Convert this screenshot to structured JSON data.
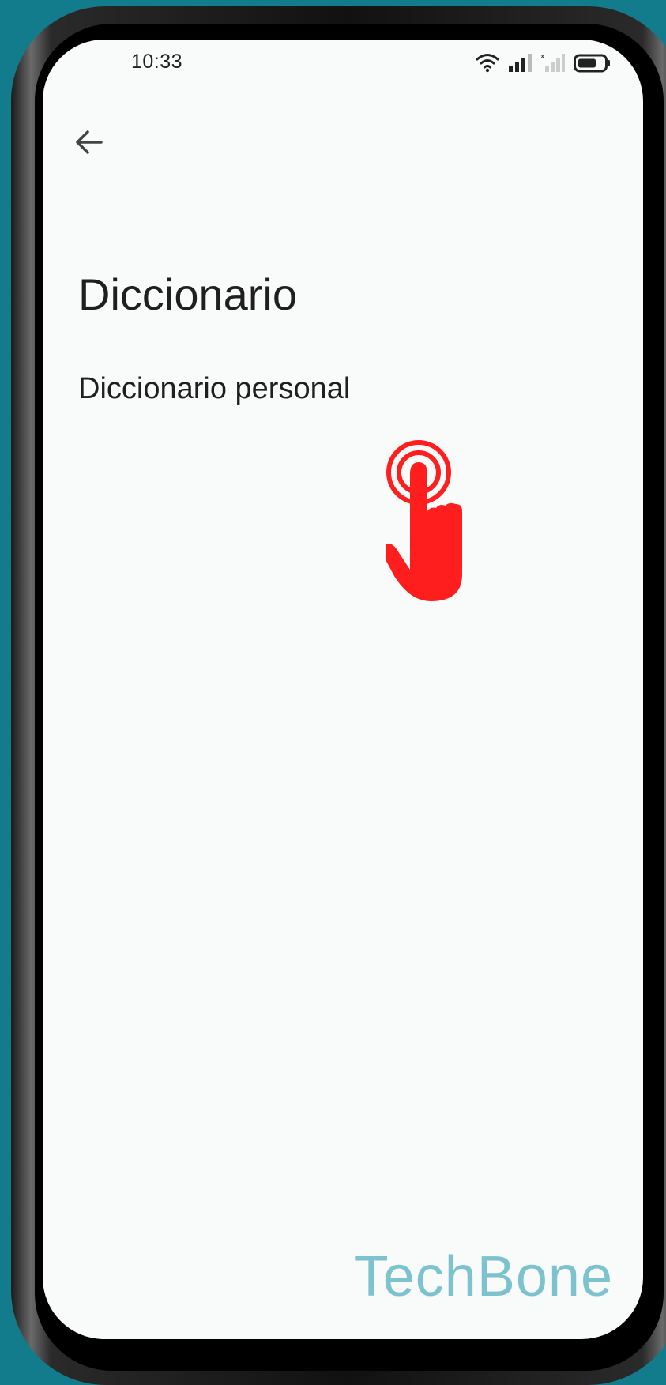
{
  "status_bar": {
    "time": "10:33"
  },
  "header": {
    "back_icon": "arrow-back-icon"
  },
  "page": {
    "title": "Diccionario",
    "items": [
      {
        "label": "Diccionario personal"
      }
    ]
  },
  "overlay": {
    "tap_indicator_icon": "tap-hand-icon",
    "tap_color": "#ff1e1e"
  },
  "watermark": {
    "text": "TechBone",
    "color": "#7cc3cf"
  },
  "colors": {
    "background": "#127b8c",
    "screen": "#f9fafa",
    "text": "#1f1f1f"
  }
}
